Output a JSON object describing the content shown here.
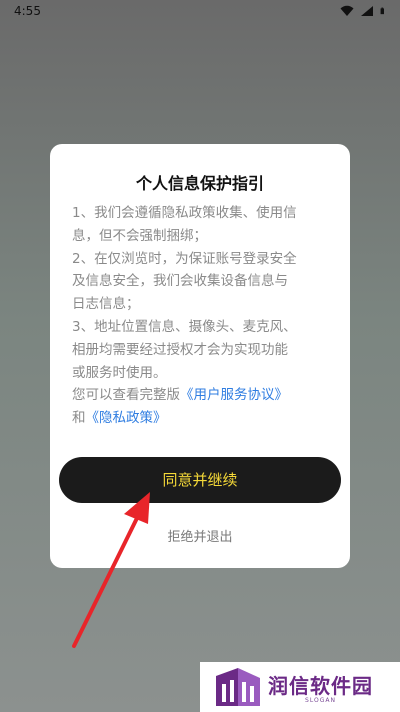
{
  "status_bar": {
    "time": "4:55",
    "icons": [
      "wifi-icon",
      "signal-icon",
      "battery-icon"
    ]
  },
  "dialog": {
    "title": "个人信息保护指引",
    "body_lines": [
      "1、我们会遵循隐私政策收集、使用信",
      "息，但不会强制捆绑；",
      "2、在仅浏览时，为保证账号登录安全",
      "及信息安全，我们会收集设备信息与",
      "日志信息；",
      "3、地址位置信息、摄像头、麦克风、",
      "相册均需要经过授权才会为实现功能",
      "或服务时使用。"
    ],
    "view_prefix": "您可以查看完整版",
    "user_agreement_link": "《用户服务协议》",
    "and_text": "和",
    "privacy_policy_link": "《隐私政策》",
    "agree_button": "同意并继续",
    "reject_link": "拒绝并退出"
  },
  "colors": {
    "link": "#2f7de1",
    "button_bg": "#1b1b1b",
    "button_text": "#f5d938",
    "arrow": "#e8252a",
    "watermark_brand": "#6b2a86"
  },
  "watermark": {
    "name": "润信软件园",
    "slogan": "SLOGAN"
  }
}
